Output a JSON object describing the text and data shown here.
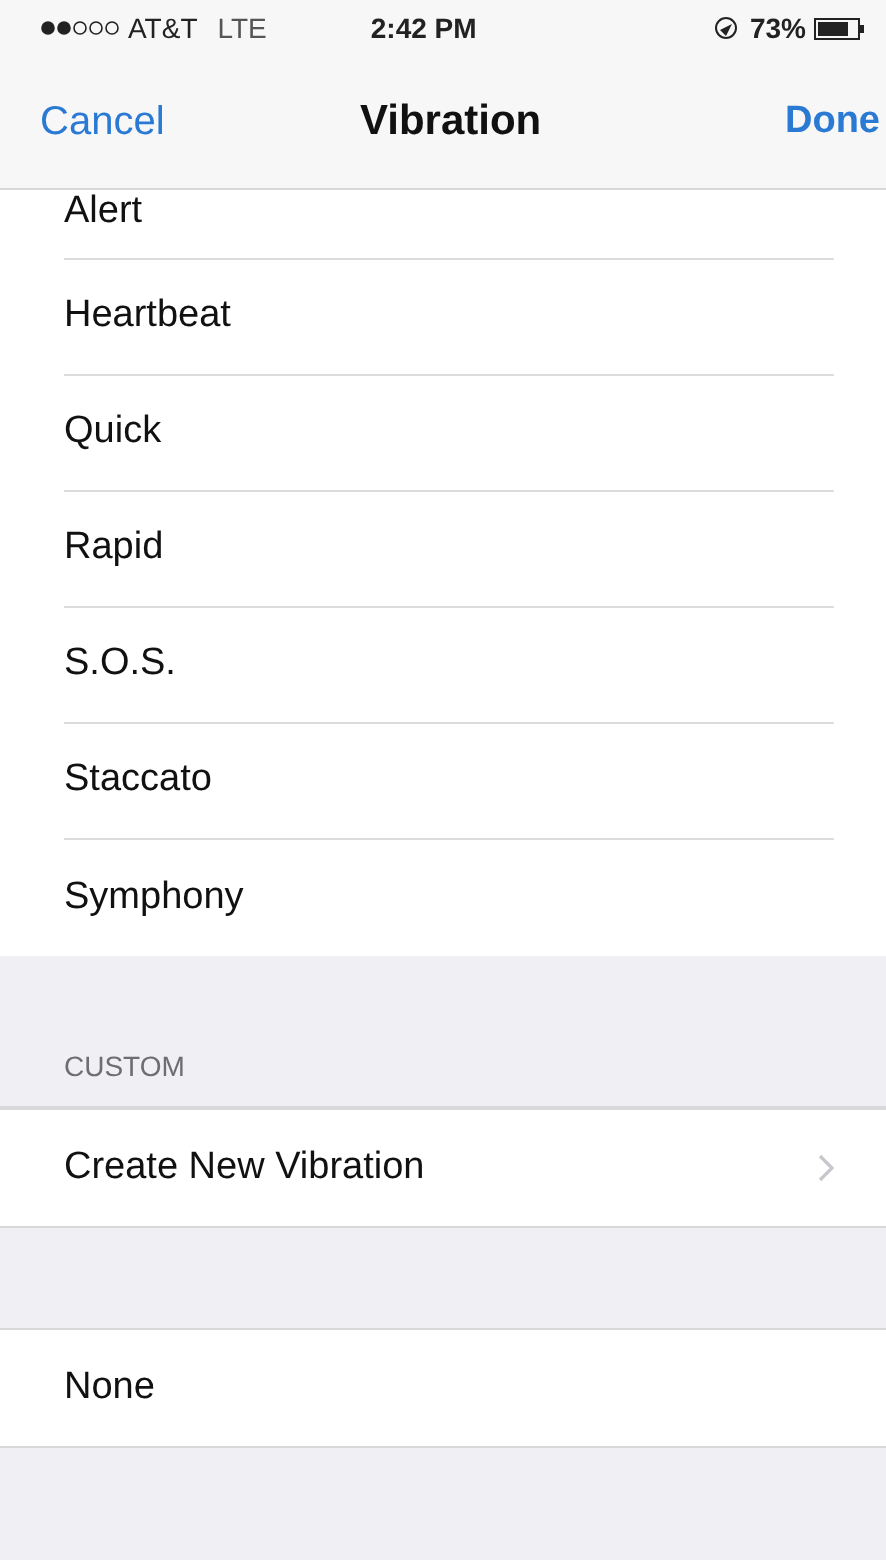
{
  "status_bar": {
    "carrier": "AT&T",
    "network": "LTE",
    "time": "2:42 PM",
    "battery_percent": "73%"
  },
  "nav_bar": {
    "left_button": "Cancel",
    "title": "Vibration",
    "right_button": "Done"
  },
  "sections": [
    {
      "items": [
        {
          "label": "Alert",
          "kind": "plain"
        },
        {
          "label": "Heartbeat",
          "kind": "plain"
        },
        {
          "label": "Quick",
          "kind": "plain"
        },
        {
          "label": "Rapid",
          "kind": "plain"
        },
        {
          "label": "S.O.S.",
          "kind": "plain"
        },
        {
          "label": "Staccato",
          "kind": "plain"
        },
        {
          "label": "Symphony",
          "kind": "plain"
        }
      ]
    },
    {
      "header": "CUSTOM",
      "items": [
        {
          "label": "Create New Vibration",
          "kind": "disclosure"
        }
      ]
    },
    {
      "items": [
        {
          "label": "None",
          "kind": "plain"
        }
      ]
    }
  ]
}
